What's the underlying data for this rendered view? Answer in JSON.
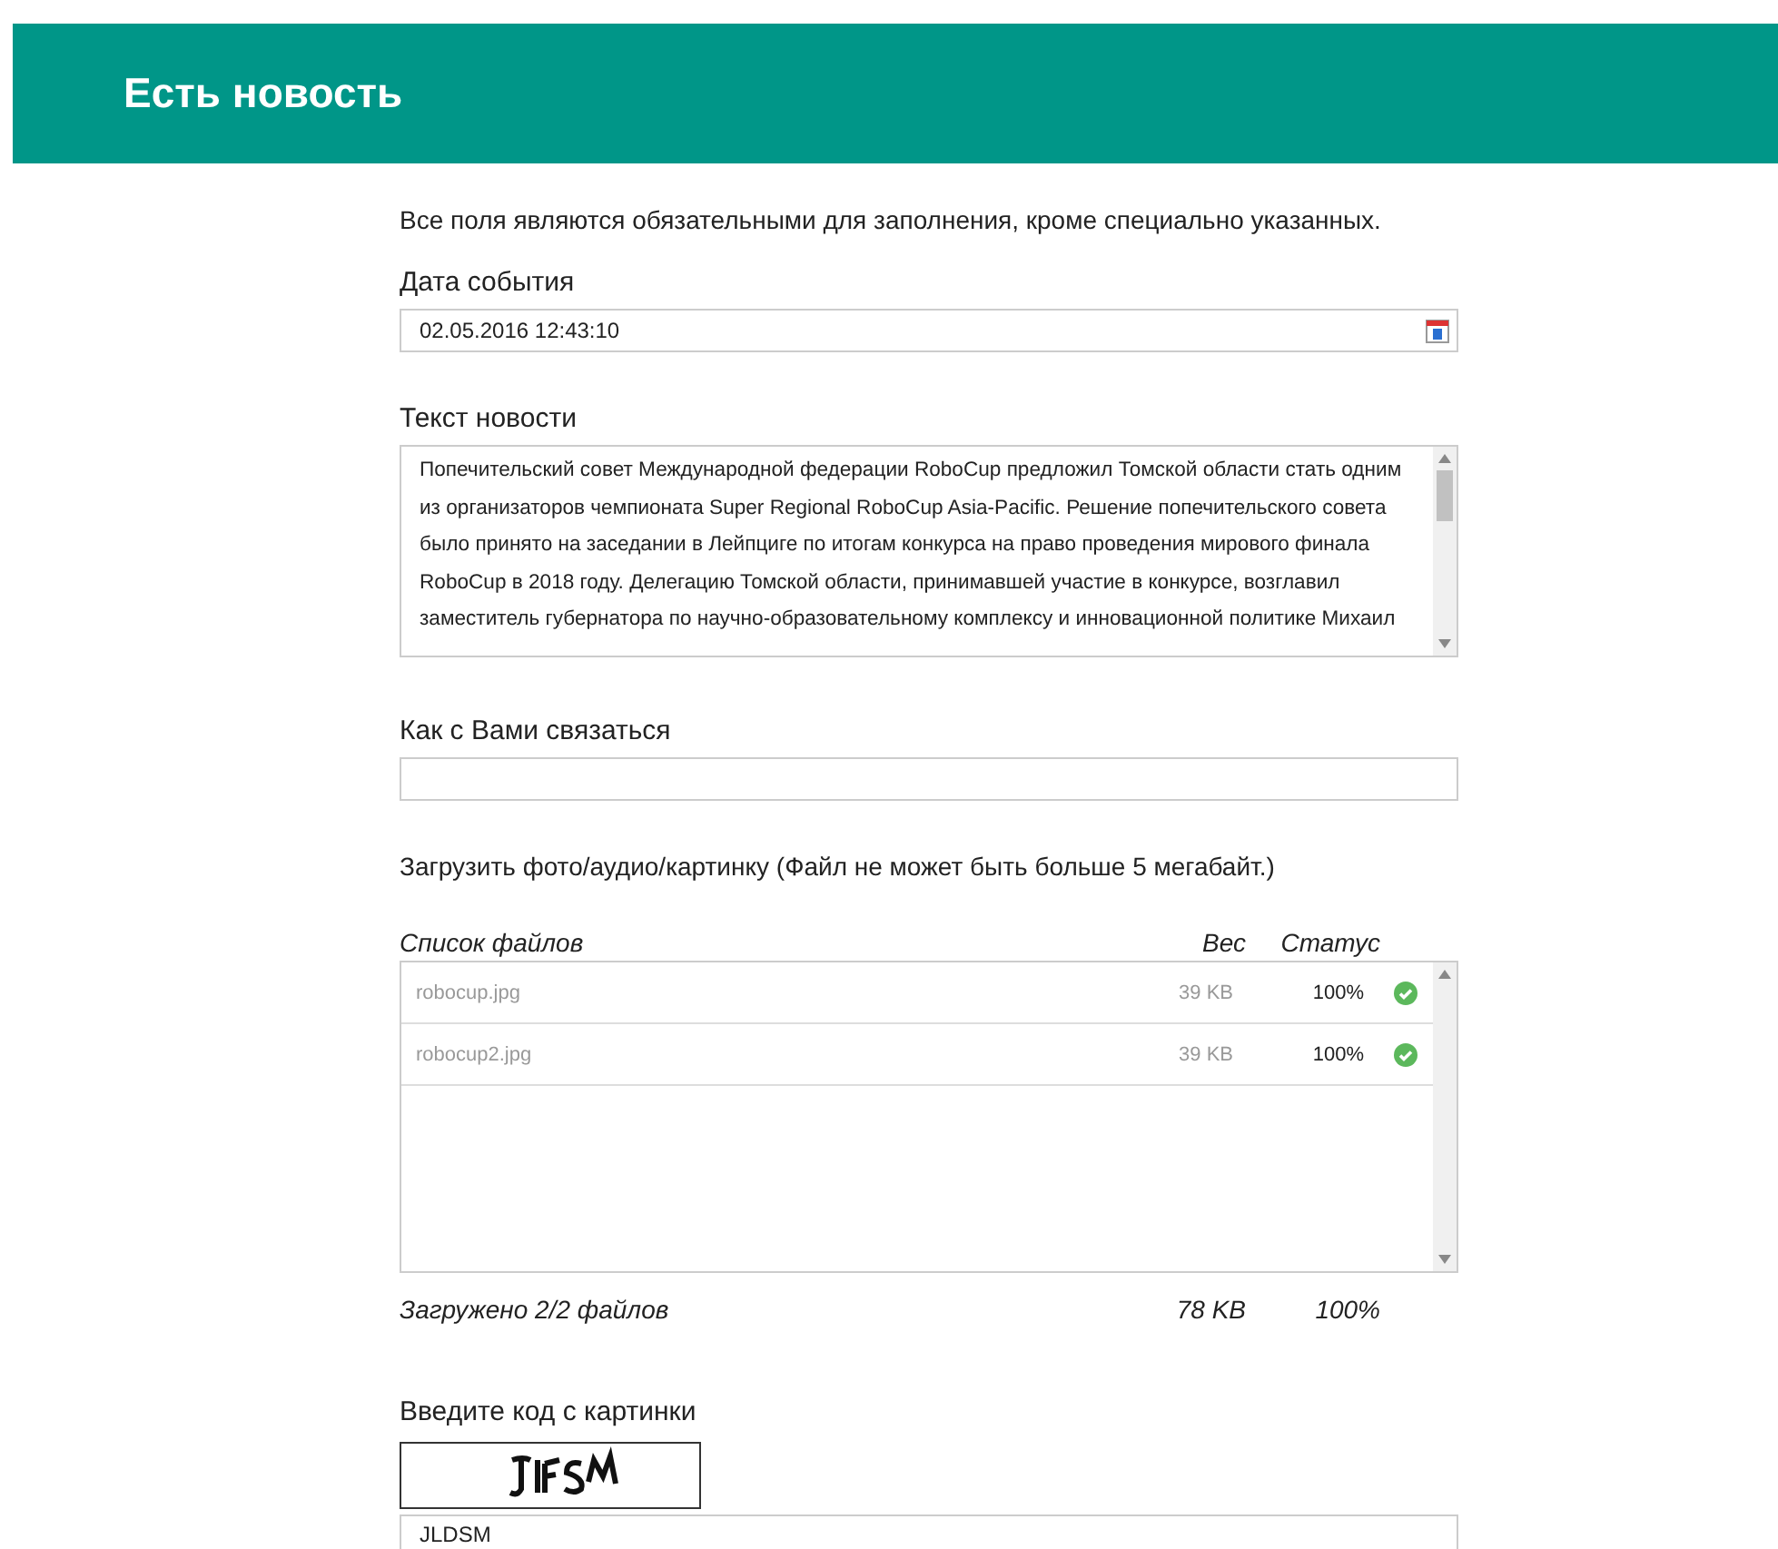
{
  "header": {
    "title": "Есть новость"
  },
  "form": {
    "intro": "Все поля являются обязательными для заполнения, кроме специально указанных.",
    "date": {
      "label": "Дата события",
      "value": "02.05.2016 12:43:10"
    },
    "news": {
      "label": "Текст новости",
      "lines": [
        "Попечительский совет Международной федерации RoboCup предложил Томской области стать одним",
        "из организаторов чемпионата Super Regional RoboCup Asia-Pacific. Решение попечительского совета",
        "было принято на заседании в Лейпциге по итогам конкурса на право проведения мирового финала",
        "RoboCup в 2018 году. Делегацию Томской области, принимавшей участие в конкурсе, возглавил",
        "заместитель губернатора по научно-образовательному комплексу и инновационной политике Михаил"
      ]
    },
    "contact": {
      "label": "Как с Вами связаться"
    },
    "upload": {
      "note": "Загрузить фото/аудио/картинку (Файл не может быть больше 5 мегабайт.)",
      "columns": [
        "Список файлов",
        "Вес",
        "Статус"
      ],
      "files": [
        {
          "name": "robocup.jpg",
          "size": "39 KB",
          "progress": "100%",
          "uploaded": true
        },
        {
          "name": "robocup2.jpg",
          "size": "39 KB",
          "progress": "100%",
          "uploaded": true
        }
      ],
      "summary": {
        "text": "Загружено 2/2 файлов",
        "size": "78 KB",
        "progress": "100%"
      }
    },
    "captcha": {
      "label": "Введите код с картинки",
      "value": "JLDSM"
    }
  }
}
